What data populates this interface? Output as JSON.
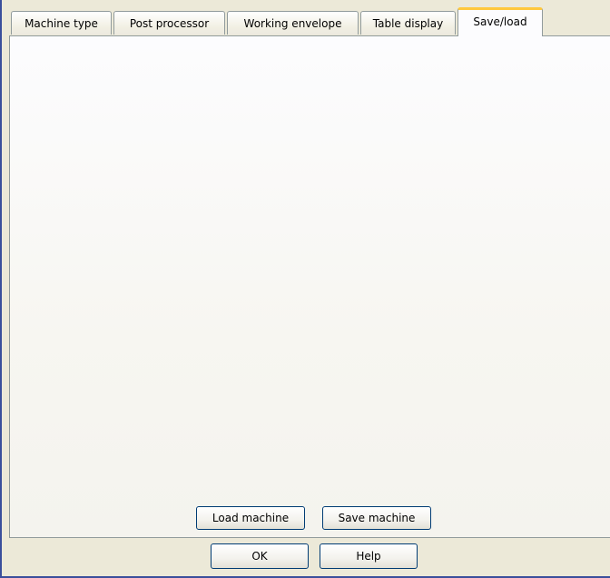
{
  "tabs": [
    {
      "label": "Machine type"
    },
    {
      "label": "Post processor"
    },
    {
      "label": "Working envelope"
    },
    {
      "label": "Table display"
    },
    {
      "label": "Save/load",
      "active": true
    }
  ],
  "panel": {
    "load_label": "Load machine",
    "save_label": "Save machine"
  },
  "dialog": {
    "ok_label": "OK",
    "help_label": "Help"
  },
  "colors": {
    "window_border": "#3a4f9c",
    "active_tab_highlight": "#ffc83c",
    "button_border": "#003c74",
    "background": "#ece9d8"
  }
}
